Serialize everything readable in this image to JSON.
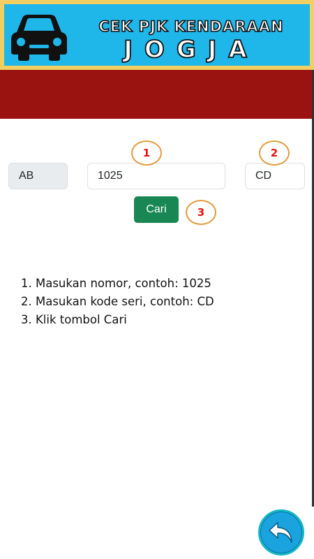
{
  "banner": {
    "line1": "CEK PJK KENDARAAN",
    "line2": "JOGJA",
    "car_icon": "car-icon",
    "colors": {
      "frame": "#f2cf63",
      "background": "#1fb6ea"
    }
  },
  "header_bar": {
    "color": "#9b1310"
  },
  "form": {
    "region_code": "AB",
    "number": "1025",
    "series": "CD",
    "search_label": "Cari",
    "search_color": "#198754"
  },
  "markers": [
    "1",
    "2",
    "3"
  ],
  "instructions": [
    "1. Masukan nomor, contoh: 1025",
    "2. Masukan kode seri, contoh: CD",
    "3. Klik tombol Cari"
  ],
  "back_button": {
    "icon": "undo-arrow-icon",
    "color": "#1aa3df"
  }
}
